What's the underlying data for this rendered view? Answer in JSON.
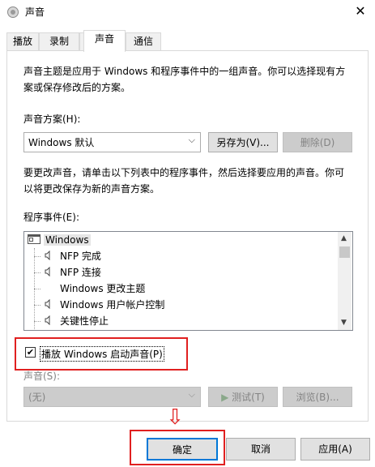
{
  "window": {
    "title": "声音",
    "close_symbol": "✕"
  },
  "tabs": [
    {
      "label": "播放"
    },
    {
      "label": "录制"
    },
    {
      "label": "声音"
    },
    {
      "label": "通信"
    }
  ],
  "description_1_line1": "声音主题是应用于 Windows 和程序事件中的一组声音。你可以选择现有方",
  "description_1_line2": "案或保存修改后的方案。",
  "scheme": {
    "label": "声音方案(H):",
    "value": "Windows 默认",
    "save_as": "另存为(V)...",
    "delete": "删除(D)"
  },
  "description_2_line1": "要更改声音，请单击以下列表中的程序事件，然后选择要应用的声音。你可",
  "description_2_line2": "以将更改保存为新的声音方案。",
  "events": {
    "label": "程序事件(E):",
    "root": "Windows",
    "items": [
      {
        "label": "NFP 完成",
        "has_sound": true
      },
      {
        "label": "NFP 连接",
        "has_sound": true
      },
      {
        "label": "Windows 更改主题",
        "has_sound": false
      },
      {
        "label": "Windows 用户帐户控制",
        "has_sound": true
      },
      {
        "label": "关键性停止",
        "has_sound": true
      }
    ]
  },
  "startup": {
    "label": "播放 Windows 启动声音(P)",
    "checked": true,
    "check_mark": "✔"
  },
  "sound": {
    "label": "声音(S):",
    "value": "(无)",
    "test": "测试(T)",
    "browse": "浏览(B)..."
  },
  "footer": {
    "ok": "确定",
    "cancel": "取消",
    "apply": "应用(A)"
  },
  "annotation": {
    "arrow_symbol": "⇩",
    "highlight_color": "#e02020"
  }
}
